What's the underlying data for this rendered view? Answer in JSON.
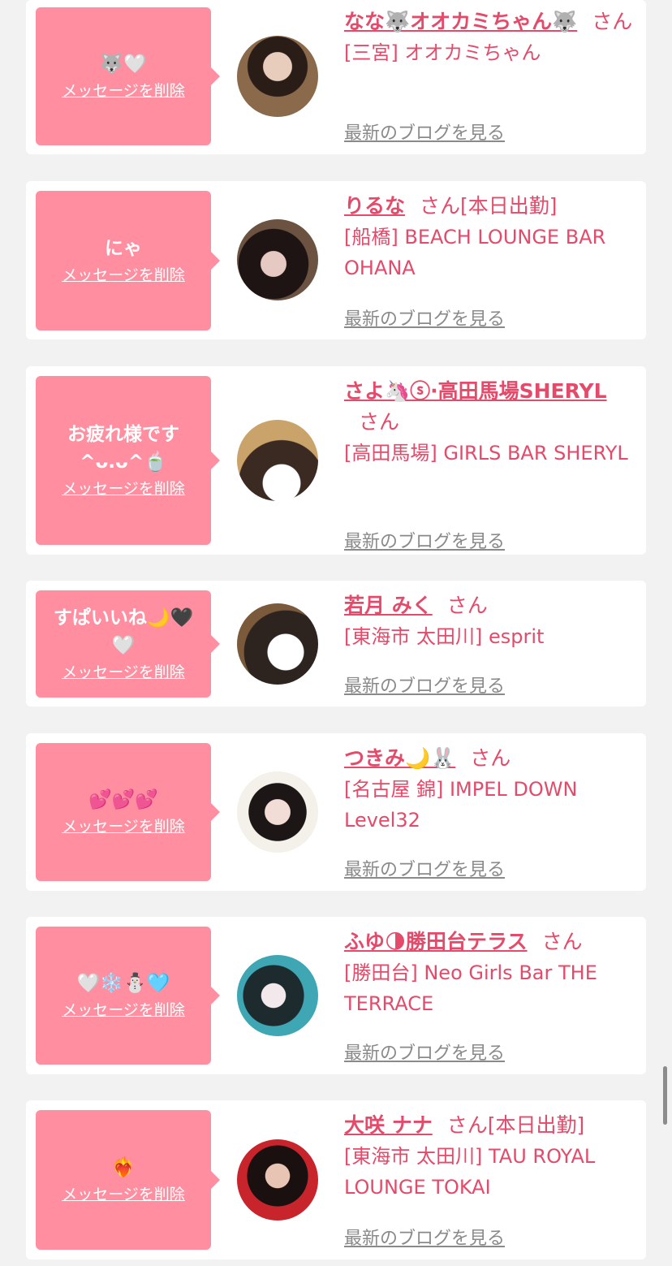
{
  "cards": [
    {
      "message": "🐺🤍",
      "delete_label": "メッセージを削除",
      "name": "なな🐺オオカミちゃん🐺",
      "honorific": "さん",
      "status": "",
      "shop": "[三宮] オオカミちゃん",
      "blog_label": "最新のブログを見る"
    },
    {
      "message": "にゃ",
      "delete_label": "メッセージを削除",
      "name": "りるな",
      "honorific": "さん",
      "status": "[本日出勤]",
      "shop": "[船橋] BEACH LOUNGE BAR OHANA",
      "blog_label": "最新のブログを見る"
    },
    {
      "message": "お疲れ様です^ᴗ.ᴗ^🍵",
      "delete_label": "メッセージを削除",
      "name": "さよ🦄ⓢ·高田馬場SHERYL",
      "honorific": "さん",
      "status": "",
      "shop": "[高田馬場] GIRLS BAR SHERYL",
      "blog_label": "最新のブログを見る"
    },
    {
      "message": "すぱいいね🌙🖤🤍",
      "delete_label": "メッセージを削除",
      "name": "若月 みく",
      "honorific": "さん",
      "status": "",
      "shop": "[東海市 太田川] esprit",
      "blog_label": "最新のブログを見る"
    },
    {
      "message": "💕💕💕",
      "delete_label": "メッセージを削除",
      "name": "つきみ🌙🐰",
      "honorific": "さん",
      "status": "",
      "shop": "[名古屋 錦] IMPEL DOWN Level32",
      "blog_label": "最新のブログを見る"
    },
    {
      "message": "🤍❄️⛄🩵",
      "delete_label": "メッセージを削除",
      "name": "ふゆ🌗勝田台テラス",
      "honorific": "さん",
      "status": "",
      "shop": "[勝田台] Neo Girls Bar THE TERRACE",
      "blog_label": "最新のブログを見る"
    },
    {
      "message": "❤️‍🔥",
      "delete_label": "メッセージを削除",
      "name": "大咲 ナナ",
      "honorific": "さん",
      "status": "[本日出勤]",
      "shop": "[東海市 太田川] TAU ROYAL LOUNGE TOKAI",
      "blog_label": "最新のブログを見る"
    }
  ],
  "colors": {
    "accent": "#e44a6a",
    "bubble": "#ff8fa0",
    "link_gray": "#8a8a8a",
    "background": "#f2f2f2"
  }
}
